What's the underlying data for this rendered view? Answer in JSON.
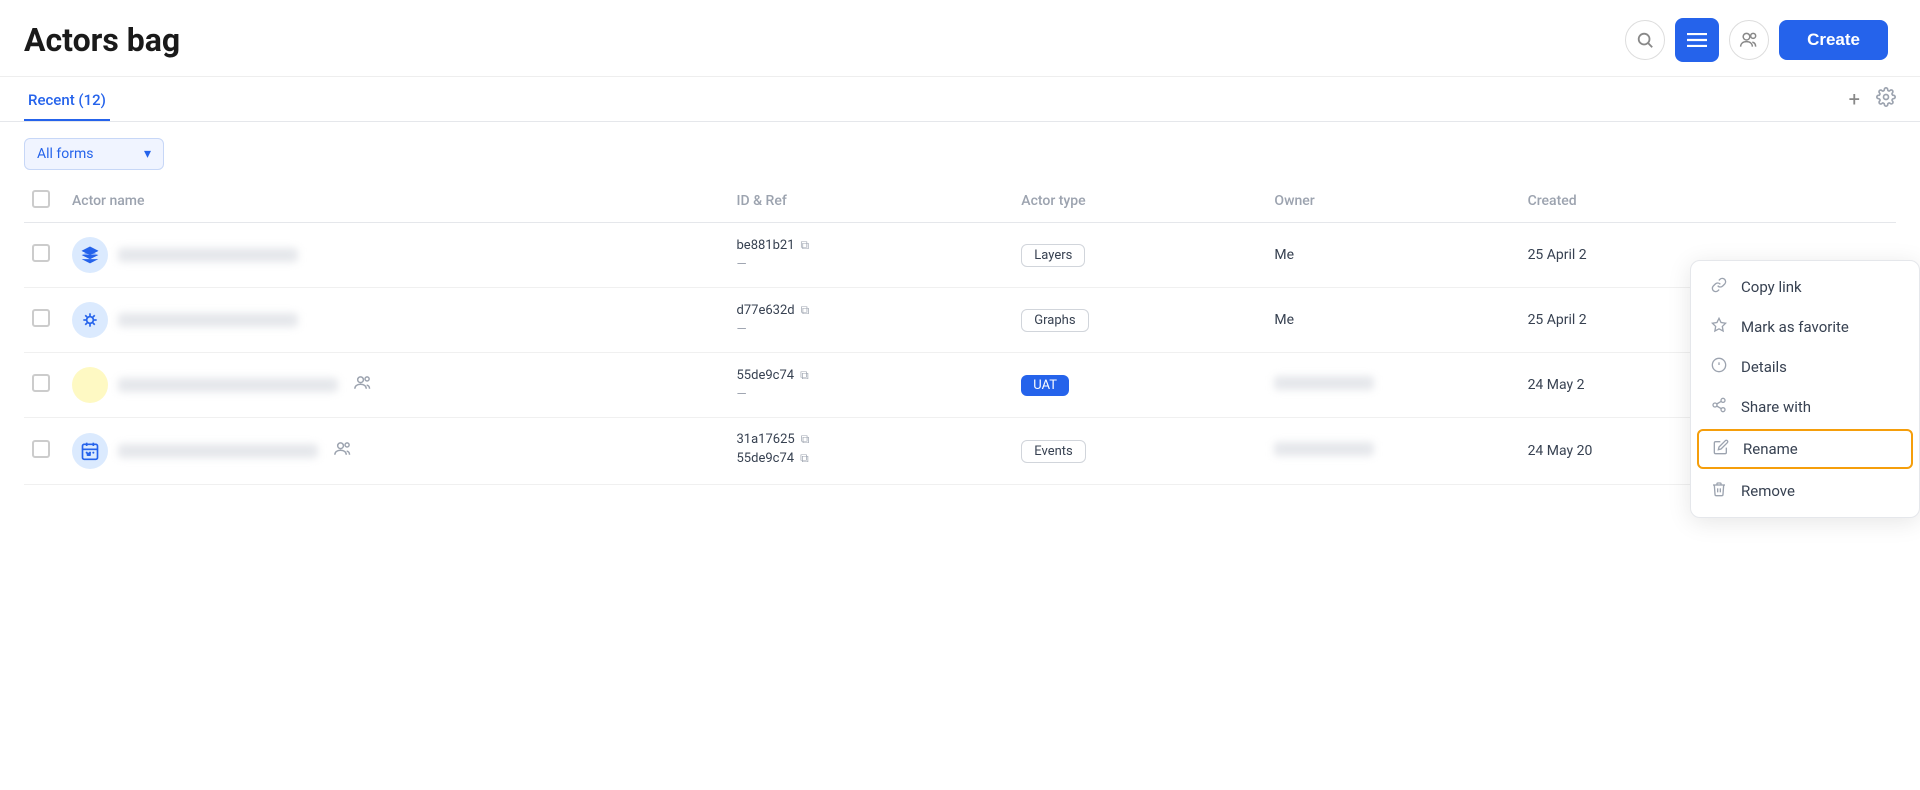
{
  "header": {
    "title": "Actors bag",
    "create_label": "Create"
  },
  "tabs": {
    "recent_label": "Recent (12)"
  },
  "filter": {
    "label": "All forms",
    "dropdown_arrow": "▾"
  },
  "table": {
    "columns": [
      "Actor name",
      "ID & Ref",
      "Actor type",
      "Owner",
      "Created"
    ],
    "rows": [
      {
        "icon_type": "layers",
        "id_primary": "be881b21",
        "id_secondary": null,
        "actor_type": "Layers",
        "actor_type_style": "badge",
        "owner": "Me",
        "created": "25 April 2",
        "shared": false
      },
      {
        "icon_type": "graph",
        "id_primary": "d77e632d",
        "id_secondary": null,
        "actor_type": "Graphs",
        "actor_type_style": "badge",
        "owner": "Me",
        "created": "25 April 2",
        "shared": false
      },
      {
        "icon_type": "circle-yellow",
        "id_primary": "55de9c74",
        "id_secondary": null,
        "actor_type": "UAT",
        "actor_type_style": "badge-blue",
        "owner": "blurred",
        "created": "24 May 2",
        "shared": true
      },
      {
        "icon_type": "calendar",
        "id_primary": "31a17625",
        "id_secondary": "55de9c74",
        "actor_type": "Events",
        "actor_type_style": "badge",
        "owner": "blurred",
        "created": "24 May 20",
        "shared": true
      }
    ]
  },
  "context_menu": {
    "items": [
      {
        "id": "copy-link",
        "label": "Copy link",
        "icon": "link"
      },
      {
        "id": "mark-favorite",
        "label": "Mark as favorite",
        "icon": "star"
      },
      {
        "id": "details",
        "label": "Details",
        "icon": "info"
      },
      {
        "id": "share-with",
        "label": "Share with",
        "icon": "share"
      },
      {
        "id": "rename",
        "label": "Rename",
        "icon": "pencil",
        "active": true
      },
      {
        "id": "remove",
        "label": "Remove",
        "icon": "trash"
      }
    ]
  }
}
